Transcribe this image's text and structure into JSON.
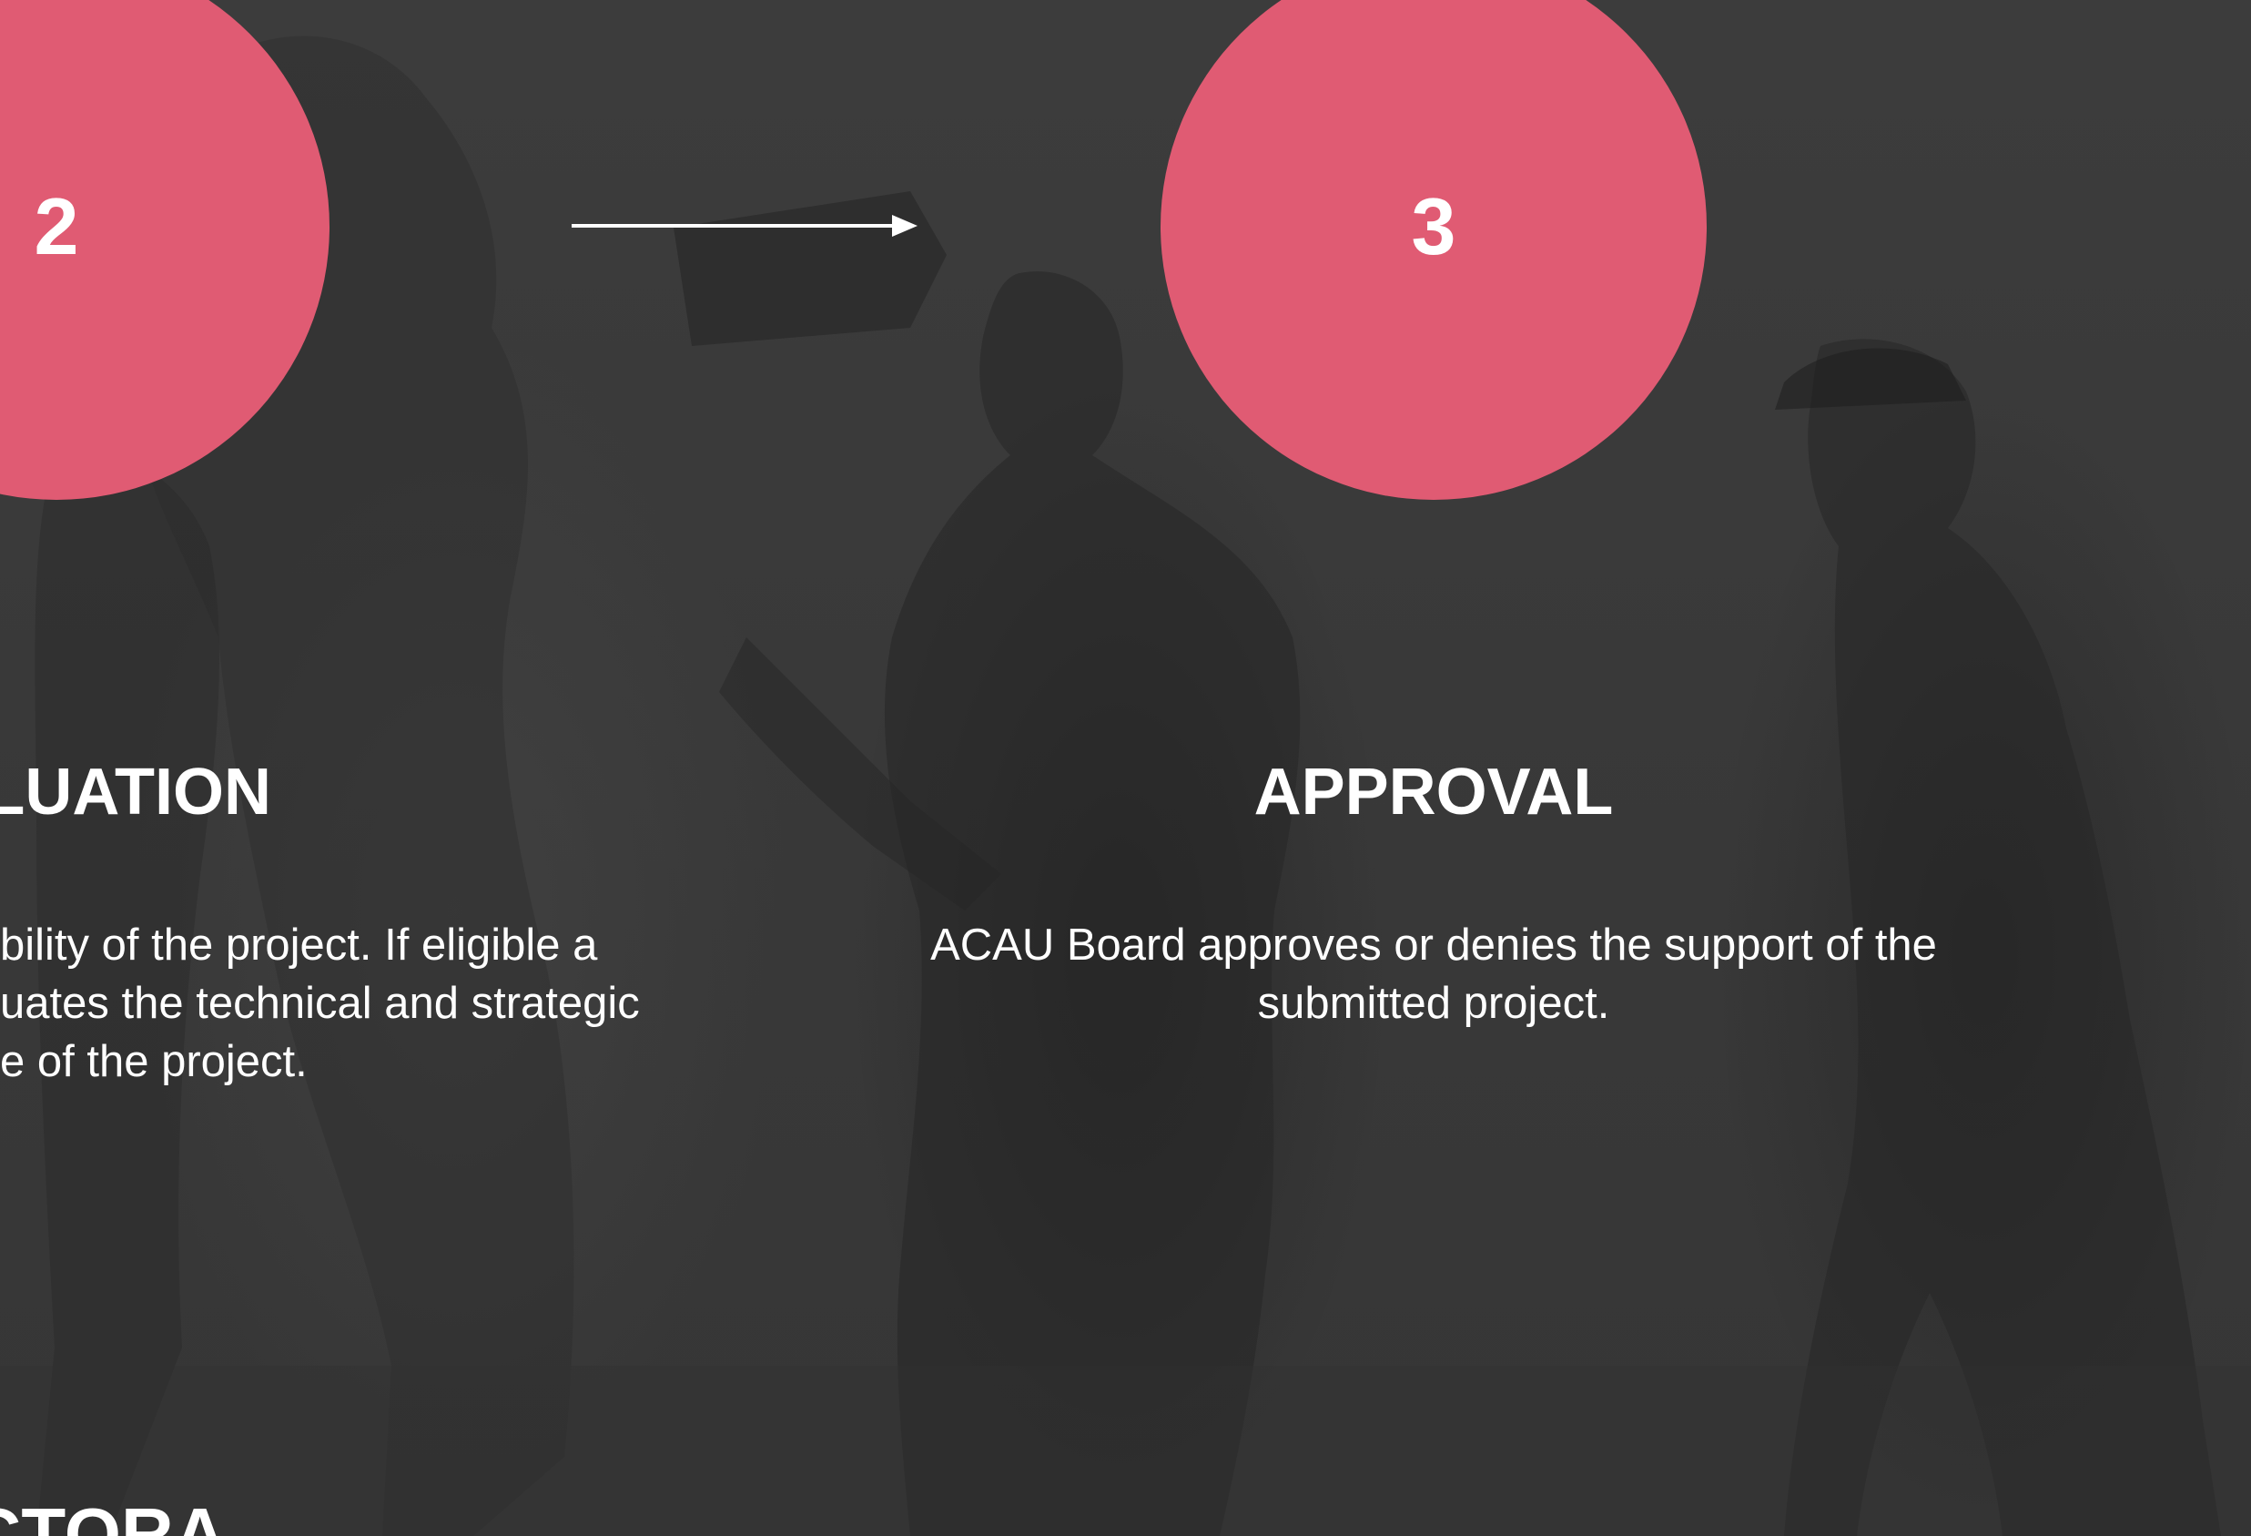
{
  "steps": [
    {
      "number": "2",
      "title": "EVALUATION",
      "visible_title": "LUATION",
      "description_lines": [
        "bility of the project. If eligible a",
        "uates the technical and strategic",
        "e of the project."
      ]
    },
    {
      "number": "3",
      "title": "APPROVAL",
      "description_lines": [
        "ACAU Board approves or denies the support of the",
        "submitted project."
      ]
    }
  ],
  "footer_fragment": "DUCTORA",
  "colors": {
    "circle": "#e05b73",
    "background": "#3a3a3a",
    "text": "#ffffff"
  },
  "icons": {
    "connector": "arrow-right-icon"
  }
}
